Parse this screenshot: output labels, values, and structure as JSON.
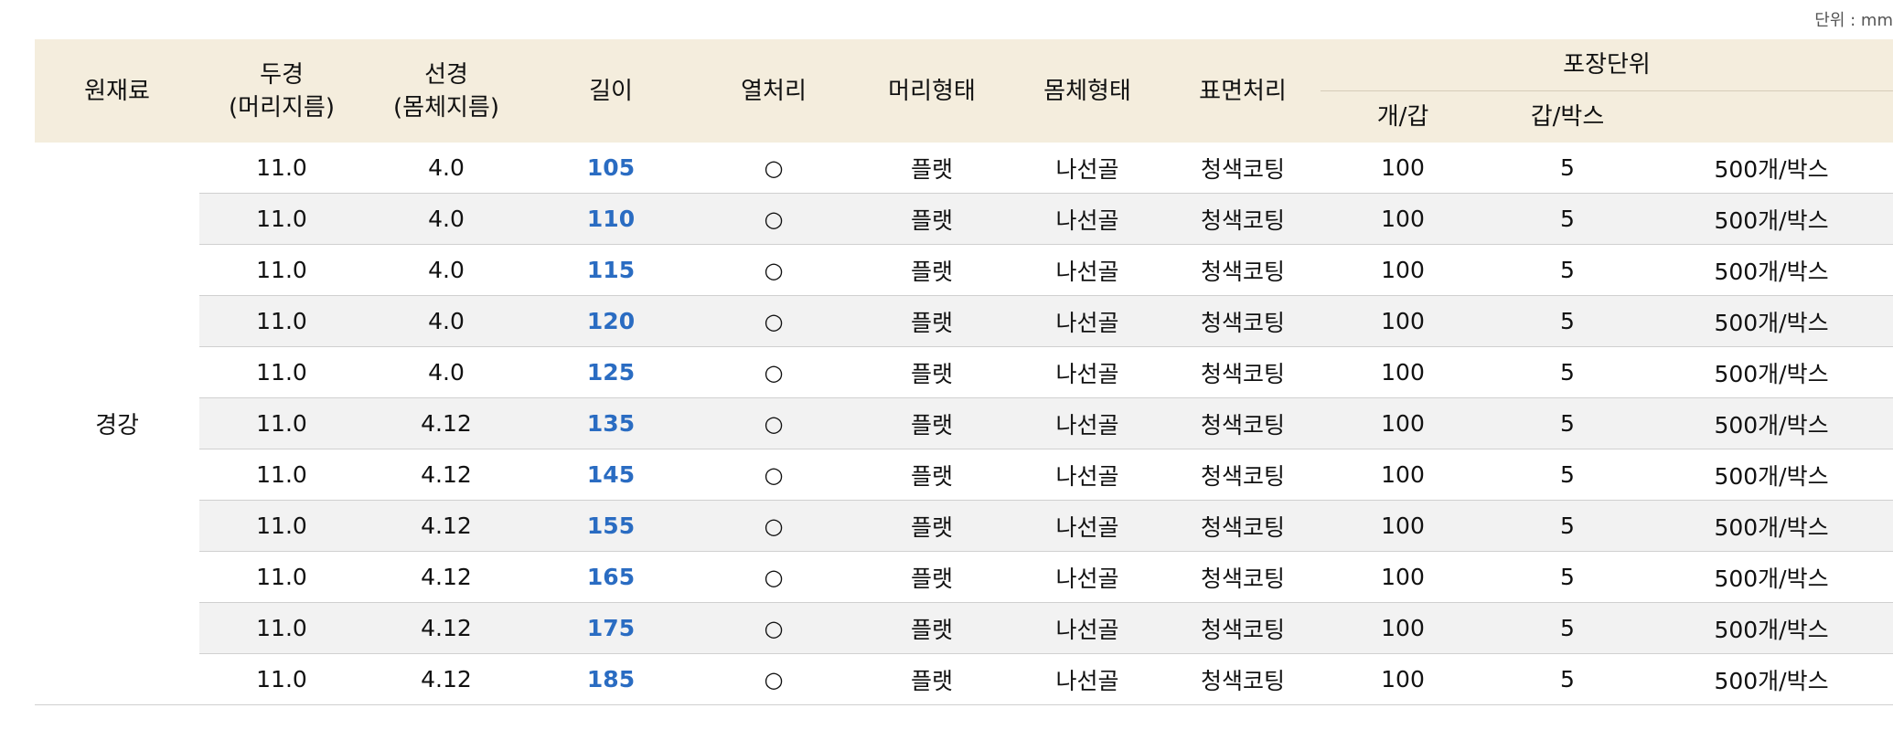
{
  "unit_note": "단위 : mm",
  "headers": {
    "material": "원재료",
    "head_diameter": "두경",
    "head_diameter_sub": "(머리지름)",
    "wire_diameter": "선경",
    "wire_diameter_sub": "(몸체지름)",
    "length": "길이",
    "heat_treatment": "열처리",
    "head_type": "머리형태",
    "body_type": "몸체형태",
    "surface_treatment": "표면처리",
    "packaging": "포장단위",
    "pcs_per_pack": "개/갑",
    "packs_per_box": "갑/박스"
  },
  "material_value": "경강",
  "rows": [
    {
      "head": "11.0",
      "wire": "4.0",
      "length": "105",
      "heat": "○",
      "head_type": "플랫",
      "body": "나선골",
      "surface": "청색코팅",
      "pcs": "100",
      "packs": "5",
      "total": "500개/박스"
    },
    {
      "head": "11.0",
      "wire": "4.0",
      "length": "110",
      "heat": "○",
      "head_type": "플랫",
      "body": "나선골",
      "surface": "청색코팅",
      "pcs": "100",
      "packs": "5",
      "total": "500개/박스"
    },
    {
      "head": "11.0",
      "wire": "4.0",
      "length": "115",
      "heat": "○",
      "head_type": "플랫",
      "body": "나선골",
      "surface": "청색코팅",
      "pcs": "100",
      "packs": "5",
      "total": "500개/박스"
    },
    {
      "head": "11.0",
      "wire": "4.0",
      "length": "120",
      "heat": "○",
      "head_type": "플랫",
      "body": "나선골",
      "surface": "청색코팅",
      "pcs": "100",
      "packs": "5",
      "total": "500개/박스"
    },
    {
      "head": "11.0",
      "wire": "4.0",
      "length": "125",
      "heat": "○",
      "head_type": "플랫",
      "body": "나선골",
      "surface": "청색코팅",
      "pcs": "100",
      "packs": "5",
      "total": "500개/박스"
    },
    {
      "head": "11.0",
      "wire": "4.12",
      "length": "135",
      "heat": "○",
      "head_type": "플랫",
      "body": "나선골",
      "surface": "청색코팅",
      "pcs": "100",
      "packs": "5",
      "total": "500개/박스"
    },
    {
      "head": "11.0",
      "wire": "4.12",
      "length": "145",
      "heat": "○",
      "head_type": "플랫",
      "body": "나선골",
      "surface": "청색코팅",
      "pcs": "100",
      "packs": "5",
      "total": "500개/박스"
    },
    {
      "head": "11.0",
      "wire": "4.12",
      "length": "155",
      "heat": "○",
      "head_type": "플랫",
      "body": "나선골",
      "surface": "청색코팅",
      "pcs": "100",
      "packs": "5",
      "total": "500개/박스"
    },
    {
      "head": "11.0",
      "wire": "4.12",
      "length": "165",
      "heat": "○",
      "head_type": "플랫",
      "body": "나선골",
      "surface": "청색코팅",
      "pcs": "100",
      "packs": "5",
      "total": "500개/박스"
    },
    {
      "head": "11.0",
      "wire": "4.12",
      "length": "175",
      "heat": "○",
      "head_type": "플랫",
      "body": "나선골",
      "surface": "청색코팅",
      "pcs": "100",
      "packs": "5",
      "total": "500개/박스"
    },
    {
      "head": "11.0",
      "wire": "4.12",
      "length": "185",
      "heat": "○",
      "head_type": "플랫",
      "body": "나선골",
      "surface": "청색코팅",
      "pcs": "100",
      "packs": "5",
      "total": "500개/박스"
    }
  ],
  "colors": {
    "header_bg": "#f4eddd",
    "stripe_bg": "#f2f2f2",
    "length_text": "#2a6cc2"
  }
}
